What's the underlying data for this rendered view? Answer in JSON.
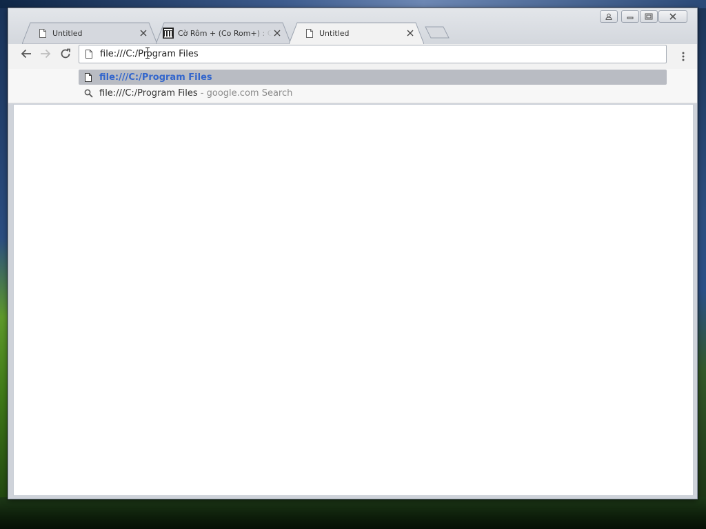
{
  "tabs": [
    {
      "title": "Untitled",
      "icon": "page-icon",
      "active": false
    },
    {
      "title": "Cờ Rôm + (Co Rom+) : Co",
      "icon": "museum-favicon-icon",
      "active": false
    },
    {
      "title": "Untitled",
      "icon": "page-icon",
      "active": true
    }
  ],
  "omnibox": {
    "value": "file:///C:/Program Files",
    "icon": "page-icon"
  },
  "suggestions": [
    {
      "icon": "page-icon",
      "text": "file:///C:/Program Files",
      "selected": true
    },
    {
      "icon": "search-icon",
      "query": "file:///C:/Program Files",
      "separator": " - ",
      "engine": "google.com Search",
      "selected": false
    }
  ],
  "colors": {
    "accent": "#3366cc",
    "selected_row": "#b9bcc3",
    "content_bg": "#ffffff"
  }
}
